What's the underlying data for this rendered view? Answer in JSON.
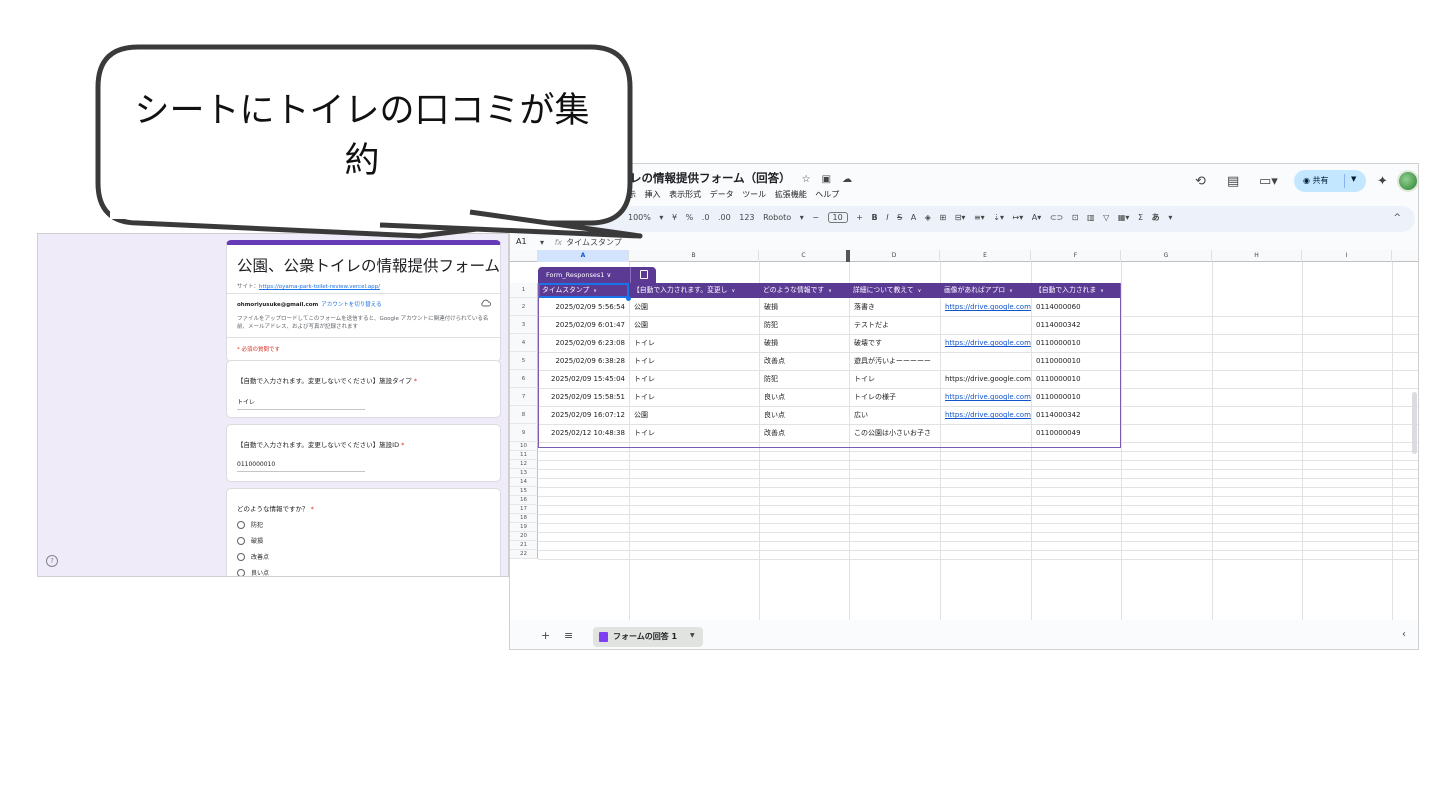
{
  "callout": {
    "line1": "シートにトイレの口コミが集",
    "line2": "約"
  },
  "form": {
    "title": "公園、公衆トイレの情報提供フォーム",
    "site_label": "サイト：",
    "site_url": "https://oyama-park-toilet-review.vercel.app/",
    "account_email": "ohmoriyusuke@gmail.com",
    "switch_account": "アカウントを切り替える",
    "description": "ファイルをアップロードしてこのフォームを送信すると、Google アカウントに関連付けられている名前、メールアドレス、および写真が記録されます",
    "required_note": "* 必須の質問です",
    "questions": [
      {
        "title": "【自動で入力されます。変更しないでください】施設タイプ",
        "value": "トイレ"
      },
      {
        "title": "【自動で入力されます。変更しないでください】施設ID",
        "value": "0110000010"
      },
      {
        "title": "どのような情報ですか？",
        "options": [
          "防犯",
          "破損",
          "改善点",
          "良い点"
        ]
      }
    ],
    "required_mark": "*"
  },
  "sheets": {
    "doc_title": "レの情報提供フォーム（回答）",
    "menu": [
      "示",
      "挿入",
      "表示形式",
      "データ",
      "ツール",
      "拡張機能",
      "ヘルプ"
    ],
    "share_label": "共有",
    "toolbar": {
      "zoom": "100%",
      "currency": "¥",
      "percent": "%",
      "dec_decrease": ".0",
      "dec_increase": ".00",
      "number_format": "123",
      "font": "Roboto",
      "font_size": "10",
      "minus": "−",
      "plus": "+",
      "bold": "B",
      "italic": "I",
      "strike": "S",
      "text_color": "A",
      "input_method": "あ"
    },
    "name_box": "A1",
    "formula": "タイムスタンプ",
    "fx": "fx",
    "columns": [
      "A",
      "B",
      "C",
      "D",
      "E",
      "F",
      "G",
      "H",
      "I"
    ],
    "table_name": "Form_Responses1",
    "table_headers": [
      "タイムスタンプ",
      "【自動で入力されます。変更し",
      "どのような情報です",
      "詳細について教えて",
      "画像があればアプロ",
      "【自動で入力されま"
    ],
    "rows": [
      [
        "2025/02/09 5:56:54",
        "公園",
        "破損",
        "落書き",
        "https://drive.google.com",
        "0114000060"
      ],
      [
        "2025/02/09 6:01:47",
        "公園",
        "防犯",
        "テストだよ",
        "",
        "0114000342"
      ],
      [
        "2025/02/09 6:23:08",
        "トイレ",
        "破損",
        "破壊です",
        "https://drive.google.com",
        "0110000010"
      ],
      [
        "2025/02/09 6:38:28",
        "トイレ",
        "改善点",
        "遊具が汚いよーーーーー",
        "",
        "0110000010"
      ],
      [
        "2025/02/09 15:45:04",
        "トイレ",
        "防犯",
        "トイレ",
        "https://drive.google.com",
        "0110000010"
      ],
      [
        "2025/02/09 15:58:51",
        "トイレ",
        "良い点",
        "トイレの様子",
        "https://drive.google.com",
        "0110000010"
      ],
      [
        "2025/02/09 16:07:12",
        "公園",
        "良い点",
        "広い",
        "https://drive.google.com",
        "0114000342"
      ],
      [
        "2025/02/12 10:48:38",
        "トイレ",
        "改善点",
        "この公園は小さいお子さ",
        "",
        "0110000049"
      ]
    ],
    "row_numbers": [
      "1",
      "2",
      "3",
      "4",
      "5",
      "6",
      "7",
      "8",
      "9",
      "10",
      "11",
      "12",
      "13",
      "14",
      "15",
      "16",
      "17",
      "18",
      "19",
      "20",
      "21",
      "22"
    ],
    "sheet_tab": "フォームの回答 1"
  }
}
